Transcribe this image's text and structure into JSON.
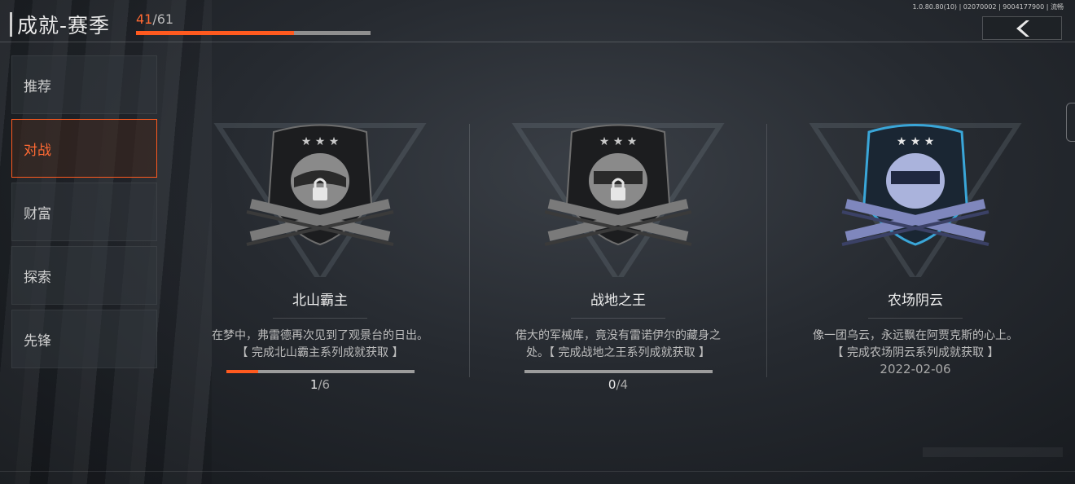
{
  "header": {
    "title": "成就-赛季",
    "progress_current": "41",
    "progress_sep": "/",
    "progress_total": "61",
    "progress_fraction": 0.672
  },
  "version_text": "1.0.80.80(10) | 02070002 | 9004177900 | 流畅",
  "back_icon": "chevron-left-icon",
  "sidebar": {
    "items": [
      {
        "label": "推荐",
        "active": false
      },
      {
        "label": "对战",
        "active": true
      },
      {
        "label": "财富",
        "active": false
      },
      {
        "label": "探索",
        "active": false
      },
      {
        "label": "先锋",
        "active": false
      }
    ]
  },
  "achievements": [
    {
      "name": "北山霸主",
      "desc_line1": "在梦中，弗雷德再次见到了观景台的日出。",
      "desc_line2": "【 完成北山霸主系列成就获取 】",
      "locked": true,
      "count_current": "1",
      "count_total": "/6",
      "progress_fraction": 0.167
    },
    {
      "name": "战地之王",
      "desc_line1": "偌大的军械库，竟没有雷诺伊尔的藏身之",
      "desc_line2": "处。【 完成战地之王系列成就获取 】",
      "locked": true,
      "count_current": "0",
      "count_total": "/4",
      "progress_fraction": 0
    },
    {
      "name": "农场阴云",
      "desc_line1": "像一团乌云，永远飘在阿贾克斯的心上。",
      "desc_line2": "【 完成农场阴云系列成就获取 】",
      "locked": false,
      "date": "2022-02-06"
    }
  ],
  "colors": {
    "accent": "#ff5a1f",
    "badge_unlocked": "#8b94c8",
    "badge_locked": "#9a9a9a",
    "unlocked_glow": "#3aa6d8"
  }
}
